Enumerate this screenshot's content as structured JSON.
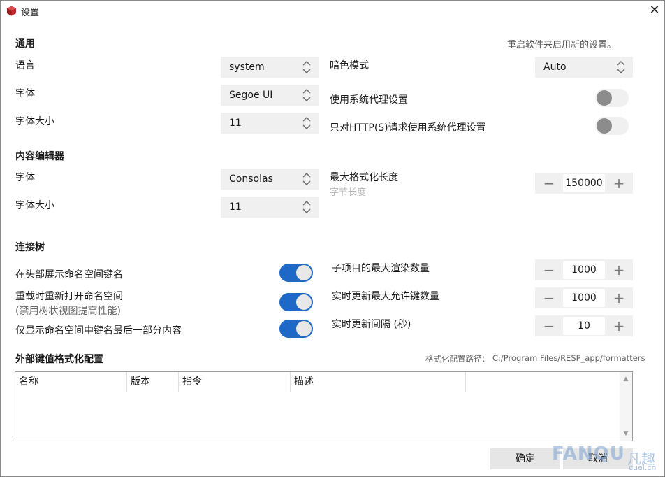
{
  "window": {
    "title": "设置",
    "close_glyph": "✕"
  },
  "general": {
    "heading": "通用",
    "restart_note": "重启软件来启用新的设置。",
    "language": {
      "label": "语言",
      "value": "system"
    },
    "font": {
      "label": "字体",
      "value": "Segoe UI"
    },
    "font_size": {
      "label": "字体大小",
      "value": "11"
    },
    "dark_mode": {
      "label": "暗色模式",
      "value": "Auto"
    },
    "system_proxy": {
      "label": "使用系统代理设置",
      "on": false
    },
    "http_proxy_only": {
      "label": "只对HTTP(S)请求使用系统代理设置",
      "on": false
    }
  },
  "editor": {
    "heading": "内容编辑器",
    "font": {
      "label": "字体",
      "value": "Consolas"
    },
    "font_size": {
      "label": "字体大小",
      "value": "11"
    },
    "max_format_length": {
      "label": "最大格式化长度",
      "hint": "字节长度",
      "value": "150000"
    }
  },
  "tree": {
    "heading": "连接树",
    "show_namespace_header": {
      "label": "在头部展示命名空间键名",
      "on": true
    },
    "reopen_namespaces": {
      "label": "重载时重新打开命名空间",
      "hint": "(禁用树状视图提高性能)",
      "on": true
    },
    "show_last_part": {
      "label": "仅显示命名空间中键名最后一部分内容",
      "on": true
    },
    "max_rendered_children": {
      "label": "子项目的最大渲染数量",
      "value": "1000"
    },
    "live_update_max_keys": {
      "label": "实时更新最大允许键数量",
      "value": "1000"
    },
    "live_update_interval": {
      "label": "实时更新间隔 (秒)",
      "value": "10"
    }
  },
  "formatters": {
    "heading": "外部键值格式化配置",
    "path_label": "格式化配置路径：",
    "path": "C:/Program Files/RESP_app/formatters",
    "columns": [
      "名称",
      "版本",
      "指令",
      "描述"
    ],
    "rows": []
  },
  "footer": {
    "ok_label": "确定",
    "cancel_label": "取消"
  },
  "icons": {
    "app": "redis-cube-icon",
    "spinner_minus": "−",
    "spinner_plus": "+",
    "scroll_up": "▲",
    "scroll_down": "▼"
  },
  "watermark": {
    "text": "FANQU",
    "cn": "凡趣",
    "site": "cuel.cn"
  },
  "colors": {
    "accent": "#1e68c8",
    "app_icon": "#c0272d"
  }
}
